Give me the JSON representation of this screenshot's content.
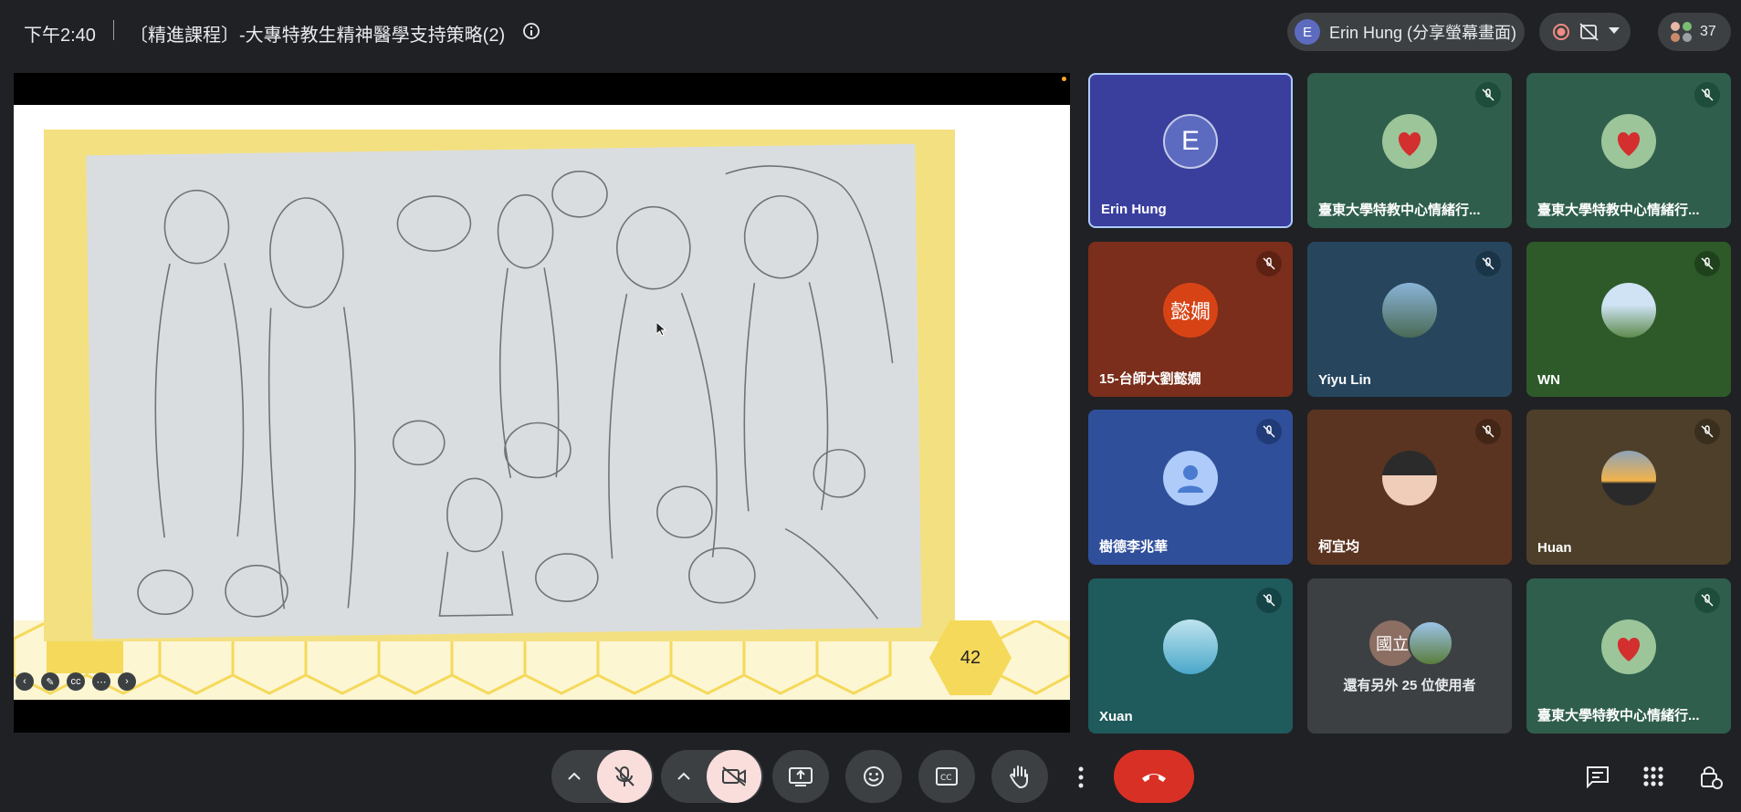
{
  "header": {
    "time": "下午2:40",
    "meeting_title": "〔精進課程〕-大專特教生精神醫學支持策略(2)",
    "presenter": {
      "initial": "E",
      "label": "Erin Hung (分享螢幕畫面)"
    },
    "participant_count": "37"
  },
  "slide": {
    "page_number": "42"
  },
  "tiles": [
    {
      "name": "Erin Hung",
      "avatar": "E",
      "muted": false
    },
    {
      "name": "臺東大學特教中心情緒行...",
      "avatar": "",
      "muted": true
    },
    {
      "name": "臺東大學特教中心情緒行...",
      "avatar": "",
      "muted": true
    },
    {
      "name": "15-台師大劉懿嫺",
      "avatar": "懿嫺",
      "muted": true
    },
    {
      "name": "Yiyu Lin",
      "avatar": "",
      "muted": true
    },
    {
      "name": "WN",
      "avatar": "",
      "muted": true
    },
    {
      "name": "樹德李兆華",
      "avatar": "",
      "muted": true
    },
    {
      "name": "柯宜均",
      "avatar": "",
      "muted": true
    },
    {
      "name": "Huan",
      "avatar": "",
      "muted": true
    },
    {
      "name": "Xuan",
      "avatar": "",
      "muted": true
    },
    {
      "name": "還有另外 25 位使用者",
      "avatar": "國立",
      "muted": false
    },
    {
      "name": "臺東大學特教中心情緒行...",
      "avatar": "",
      "muted": true
    }
  ],
  "icons": {
    "mic": "mic-off-icon",
    "camera": "camera-off-icon",
    "present": "present-screen-icon",
    "emoji": "emoji-icon",
    "captions": "captions-icon",
    "hand": "raise-hand-icon",
    "more": "more-options-icon",
    "end": "end-call-icon",
    "chat": "chat-icon",
    "apps": "apps-icon",
    "host": "host-controls-icon"
  }
}
